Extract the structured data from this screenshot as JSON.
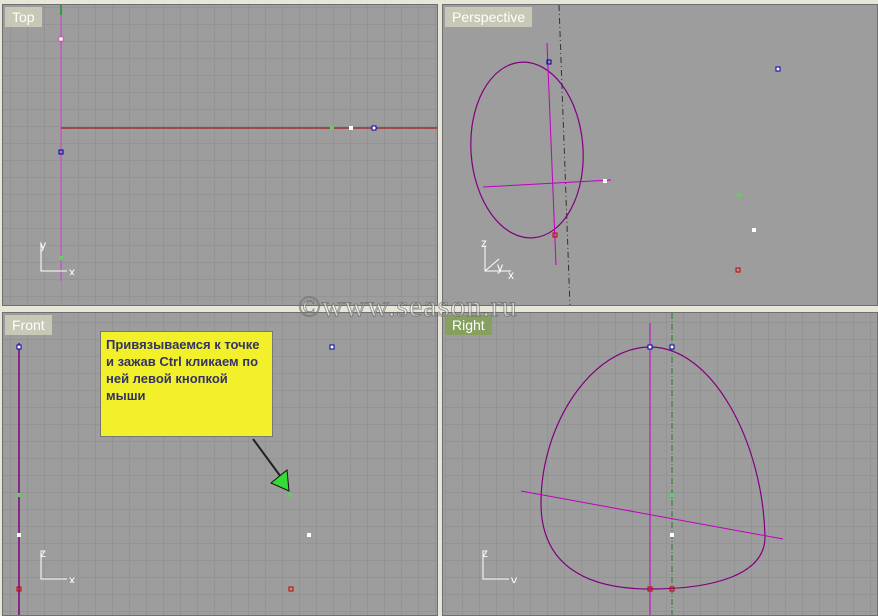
{
  "viewports": [
    {
      "label": "Top",
      "axes": [
        "y",
        "x"
      ]
    },
    {
      "label": "Perspective",
      "axes": [
        "z",
        "y",
        "x"
      ]
    },
    {
      "label": "Front",
      "axes": [
        "z",
        "x"
      ]
    },
    {
      "label": "Right",
      "axes": [
        "z",
        "y"
      ]
    }
  ],
  "active_viewport": "Right",
  "callout": {
    "text": "Привязываемся к точке и зажав Ctrl кликаем по ней левой кнопкой мыши"
  },
  "watermark": "©www.season.ru",
  "colors": {
    "viewport_bg": "#9d9d9d",
    "grid": "#8a8a8a",
    "curve": "#800080",
    "callout_bg": "#f2f02a",
    "active_label": "#86a060"
  }
}
